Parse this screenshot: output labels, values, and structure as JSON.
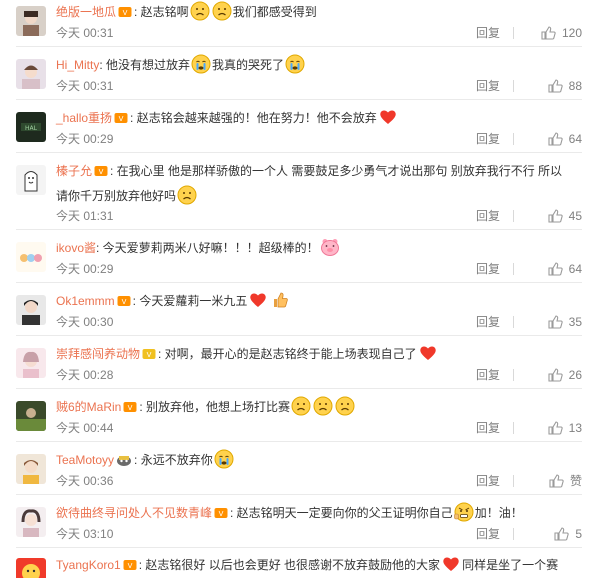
{
  "reply_label": "回复",
  "colors": {
    "username": "#eb7350",
    "meta": "#808080",
    "text": "#333333"
  },
  "comments": [
    {
      "user": "绝版一地瓜",
      "badge": "vip-badge",
      "parts": [
        ": 赵志铭啊",
        "",
        "我们都感受得到"
      ],
      "emojis": [
        "sad-face-emoji",
        "sad-face-emoji"
      ],
      "time": "今天 00:31",
      "likes": "120"
    },
    {
      "user": "Hi_Mitty",
      "badge": "",
      "parts": ": 他没有想过放弃",
      "tail": "我真的哭死了",
      "emojis": [
        "crying-face-emoji",
        "crying-face-emoji"
      ],
      "time": "今天 00:31",
      "likes": "88"
    },
    {
      "user": "_hallo重扬",
      "badge": "vip-badge",
      "parts": ": 赵志铭会越来越强的！他在努力！他不会放弃",
      "emojis": [
        "red-heart-emoji"
      ],
      "time": "今天 00:29",
      "likes": "64"
    },
    {
      "user": "榛子允",
      "badge": "vip-badge",
      "line1": ": 在我心里 他是那样骄傲的一个人 需要鼓足多少勇气才说出那句 别放弃我行不行 所以",
      "line2": "请你千万别放弃他好吗",
      "emojis": [
        "sad-face-emoji"
      ],
      "time": "今天 01:31",
      "likes": "45"
    },
    {
      "user": "ikovo酱",
      "badge": "",
      "parts": ": 今天爱萝莉两米八好嘛！！！超级棒的！",
      "emojis": [
        "pink-pig-emoji"
      ],
      "time": "今天 00:29",
      "likes": "64"
    },
    {
      "user": "Ok1emmm",
      "badge": "vip-badge",
      "parts": ": 今天爱蘿莉一米九五",
      "emojis": [
        "red-heart-emoji",
        "thumbs-up-emoji"
      ],
      "time": "今天 00:30",
      "likes": "35"
    },
    {
      "user": "崇拜感闯养动物",
      "badge": "vip-badge",
      "parts": ": 对啊，最开心的是赵志铭终于能上场表现自己了",
      "emojis": [
        "red-heart-emoji"
      ],
      "time": "今天 00:28",
      "likes": "26"
    },
    {
      "user": "贼6的MaRin",
      "badge": "vip-badge",
      "parts": ": 别放弃他，他想上场打比赛",
      "emojis": [
        "sad-face-emoji",
        "sad-face-emoji",
        "sad-face-emoji"
      ],
      "time": "今天 00:44",
      "likes": "13"
    },
    {
      "user": "TeaMotoyy",
      "badge": "vip-badge",
      "parts": ": 永远不放弃你",
      "emojis": [
        "crying-face-emoji"
      ],
      "time": "今天 00:36",
      "likes": "赞"
    },
    {
      "user": "欲待曲终寻问处人不见数青峰",
      "badge": "vip-badge",
      "parts": ": 赵志铭明天一定要向你的父王证明你自己",
      "tail": "加！油！",
      "emojis": [
        "angry-fist-emoji"
      ],
      "time": "今天 03:10",
      "likes": "5"
    },
    {
      "user": "TyangKoro1",
      "badge": "vip-badge",
      "parts": ": 赵志铭很好 以后也会更好 也很感谢不放弃鼓励他的大家",
      "tail": "同样是坐了一个赛",
      "emojis": [
        "red-heart-emoji"
      ],
      "time": "",
      "likes": ""
    }
  ]
}
